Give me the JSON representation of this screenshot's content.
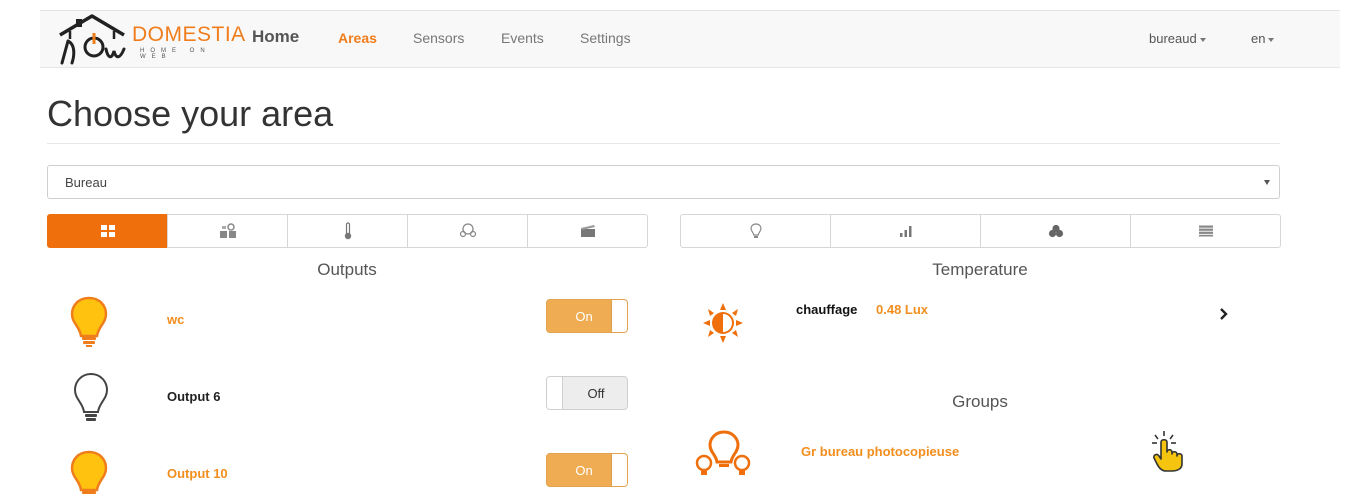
{
  "brand": {
    "logo_script": "how",
    "name": "DOMESTIA",
    "tagline": "HOME ON WEB",
    "accent": "#f07d1c"
  },
  "nav": {
    "home": "Home",
    "links": [
      {
        "label": "Areas",
        "active": true
      },
      {
        "label": "Sensors",
        "active": false
      },
      {
        "label": "Events",
        "active": false
      },
      {
        "label": "Settings",
        "active": false
      }
    ],
    "user": "bureaud",
    "lang": "en"
  },
  "page": {
    "title": "Choose your area"
  },
  "area_select": {
    "value": "Bureau"
  },
  "left_tabs": [
    {
      "icon": "grid-icon",
      "active": true
    },
    {
      "icon": "devices-icon",
      "active": false
    },
    {
      "icon": "thermometer-icon",
      "active": false
    },
    {
      "icon": "bulbs-icon",
      "active": false
    },
    {
      "icon": "clapperboard-icon",
      "active": false
    }
  ],
  "right_tabs": [
    {
      "icon": "lightbulb-icon",
      "active": false
    },
    {
      "icon": "signal-icon",
      "active": false
    },
    {
      "icon": "circles-icon",
      "active": false
    },
    {
      "icon": "shutter-icon",
      "active": false
    }
  ],
  "outputs": {
    "title": "Outputs",
    "items": [
      {
        "name": "wc",
        "state": "On",
        "is_on": true
      },
      {
        "name": "Output 6",
        "state": "Off",
        "is_on": false
      },
      {
        "name": "Output 10",
        "state": "On",
        "is_on": true
      }
    ]
  },
  "temperature": {
    "title": "Temperature",
    "sensor": {
      "name": "chauffage",
      "value": "0.48 Lux"
    }
  },
  "groups": {
    "title": "Groups",
    "items": [
      {
        "name": "Gr bureau photocopieuse"
      }
    ]
  },
  "colors": {
    "orange": "#ee6f0b",
    "bulb_yellow": "#ffc20e",
    "toggle_on": "#f0ac52"
  }
}
